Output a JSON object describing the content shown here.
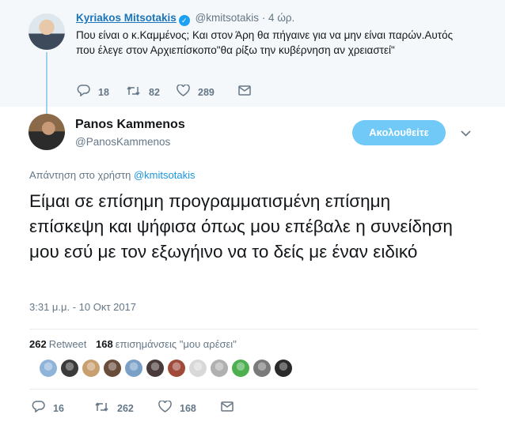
{
  "parent_tweet": {
    "name": "Kyriakos Mitsotakis",
    "handle": "@kmitsotakis",
    "time": "· 4 ώρ.",
    "text": "Που είναι ο κ.Καμμένος; Και στον Άρη θα πήγαινε για να μην είναι παρών.Αυτός που έλεγε στον Αρχιεπίσκοπο\"θα ρίξω την κυβέρνηση αν χρειαστεί\"",
    "replies": "18",
    "retweets": "82",
    "likes": "289"
  },
  "main_tweet": {
    "name": "Panos Kammenos",
    "handle": "@PanosKammenos",
    "follow_label": "Ακολουθείτε",
    "reply_prefix": "Απάντηση στο χρήστη",
    "reply_mention": "@kmitsotakis",
    "text": "Είμαι σε επίσημη προγραμματισμένη επίσημη επίσκεψη και ψήφισα όπως μου επέβαλε η συνείδηση μου εσύ με τον εξωγήινο να το δείς με έναν ειδικό",
    "timestamp": "3:31 μ.μ. - 10 Οκτ 2017",
    "retweet_count": "262",
    "retweet_label": "Retweet",
    "like_count": "168",
    "like_label": "επισημάνσεις \"μου αρέσει\"",
    "likers": [
      {
        "name": "liker-1",
        "color": "#8fb3d9"
      },
      {
        "name": "liker-2",
        "color": "#3a3a3a"
      },
      {
        "name": "liker-3",
        "color": "#c8a070"
      },
      {
        "name": "liker-4",
        "color": "#6a4c3a"
      },
      {
        "name": "liker-5",
        "color": "#7aa0c8"
      },
      {
        "name": "liker-6",
        "color": "#4a3a3a"
      },
      {
        "name": "liker-7",
        "color": "#a04a3a"
      },
      {
        "name": "liker-8",
        "color": "#d8d8d8"
      },
      {
        "name": "liker-9",
        "color": "#b0b0b0"
      },
      {
        "name": "liker-10",
        "color": "#4caf50"
      },
      {
        "name": "liker-11",
        "color": "#7a7a7a"
      },
      {
        "name": "liker-12",
        "color": "#2a2a2a"
      }
    ],
    "replies": "16",
    "retweets": "262",
    "likes": "168"
  },
  "colors": {
    "link": "#1b95e0",
    "follow_button": "#71c9f8",
    "muted": "#657786"
  }
}
